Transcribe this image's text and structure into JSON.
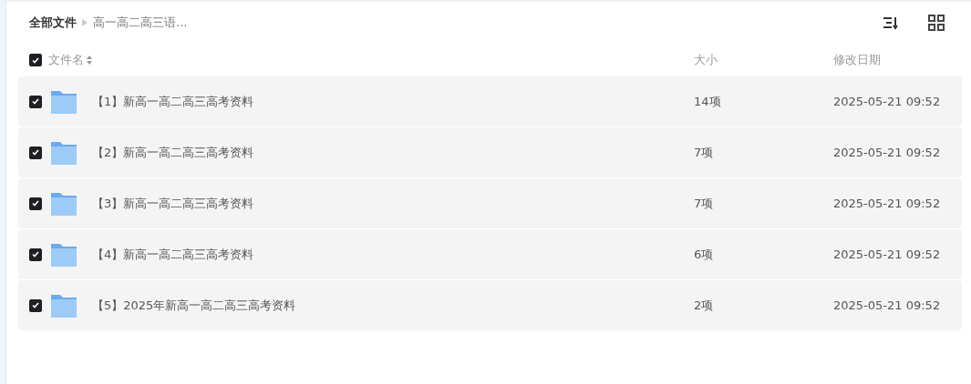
{
  "breadcrumb": [
    {
      "label": "全部文件"
    },
    {
      "label": "高一高二高三语..."
    }
  ],
  "header": {
    "checked": true,
    "columns": [
      "文件名",
      "大小",
      "修改日期"
    ]
  },
  "rows": [
    {
      "name": "【1】新高一高二高三高考资料",
      "size": "14项",
      "modified": "2025-05-21 09:52",
      "checked": true
    },
    {
      "name": "【2】新高一高二高三高考资料",
      "size": "7项",
      "modified": "2025-05-21 09:52",
      "checked": true
    },
    {
      "name": "【3】新高一高二高三高考资料",
      "size": "7项",
      "modified": "2025-05-21 09:52",
      "checked": true
    },
    {
      "name": "【4】新高一高二高三高考资料",
      "size": "6项",
      "modified": "2025-05-21 09:52",
      "checked": true
    },
    {
      "name": "【5】2025年新高一高二高三高考资料",
      "size": "2项",
      "modified": "2025-05-21 09:52",
      "checked": true
    }
  ]
}
